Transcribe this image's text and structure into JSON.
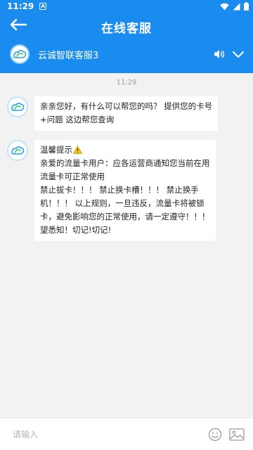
{
  "status_bar": {
    "time": "11:29",
    "notification_icon": "notification-a-icon",
    "icons": [
      "wifi-icon",
      "signal-icon",
      "battery-icon"
    ]
  },
  "header": {
    "title": "在线客服",
    "back_icon": "arrow-left-icon",
    "background_color": "#1a8cf0"
  },
  "agent": {
    "name": "云诚智联客服3",
    "avatar_icon": "cloud-logo-icon",
    "volume_icon": "volume-icon",
    "expand_icon": "chevron-down-icon"
  },
  "chat": {
    "timestamp": "11:29",
    "messages": [
      {
        "sender": "agent",
        "lines": [
          "亲亲您好，有什么可以帮您的吗？ 提供您的卡号",
          "+问题 这边帮您查询"
        ]
      },
      {
        "sender": "agent",
        "lines": [
          "温馨提示",
          "亲爱的流量卡用户：应各运营商通知您当前在用",
          "流量卡可正常使用",
          "禁止拔卡！！！ 禁止换卡槽！！！ 禁止换手",
          "机！！！ 以上规则，一旦违反，流量卡将被锁",
          "卡，避免影响您的正常使用，请一定遵守！！！",
          "望悉知！切记!切记!"
        ],
        "warning_icon": "warning-icon"
      }
    ]
  },
  "input_bar": {
    "placeholder": "请输入",
    "value": "",
    "emoji_icon": "emoji-icon",
    "image_icon": "image-icon"
  }
}
